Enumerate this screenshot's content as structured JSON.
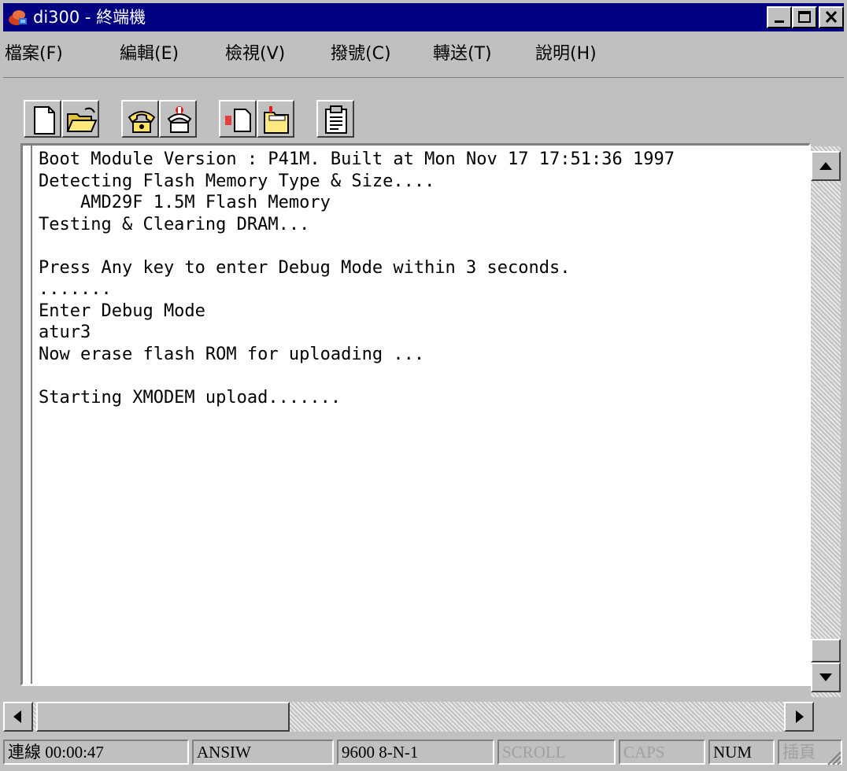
{
  "window": {
    "title": "di300 - 終端機",
    "icon": "phone-connection-icon",
    "controls": [
      "minimize-icon",
      "maximize-icon",
      "close-icon"
    ]
  },
  "menu": {
    "items": [
      {
        "label": "檔案(F)"
      },
      {
        "label": "編輯(E)"
      },
      {
        "label": "檢視(V)"
      },
      {
        "label": "撥號(C)"
      },
      {
        "label": "轉送(T)"
      },
      {
        "label": "說明(H)"
      }
    ]
  },
  "toolbar": {
    "buttons": [
      "new-file-icon",
      "open-folder-icon",
      "call-icon",
      "disconnect-icon",
      "send-icon",
      "receive-icon",
      "properties-icon"
    ]
  },
  "terminal": {
    "lines": [
      "Boot Module Version : P41M. Built at Mon Nov 17 17:51:36 1997",
      "Detecting Flash Memory Type & Size....",
      "    AMD29F 1.5M Flash Memory",
      "Testing & Clearing DRAM...",
      "",
      "Press Any key to enter Debug Mode within 3 seconds.",
      ".......",
      "Enter Debug Mode",
      "atur3",
      "Now erase flash ROM for uploading ...",
      "",
      "Starting XMODEM upload......."
    ]
  },
  "status": {
    "connection": "連線 00:00:47",
    "emulation": "ANSIW",
    "port_settings": "9600 8-N-1",
    "scroll": "SCROLL",
    "caps": "CAPS",
    "num": "NUM",
    "insert": "插頁"
  },
  "colors": {
    "title_bar": "#000080",
    "chrome": "#c0c0c0",
    "terminal_bg": "#ffffff",
    "disabled_text": "#a0a0a0"
  }
}
